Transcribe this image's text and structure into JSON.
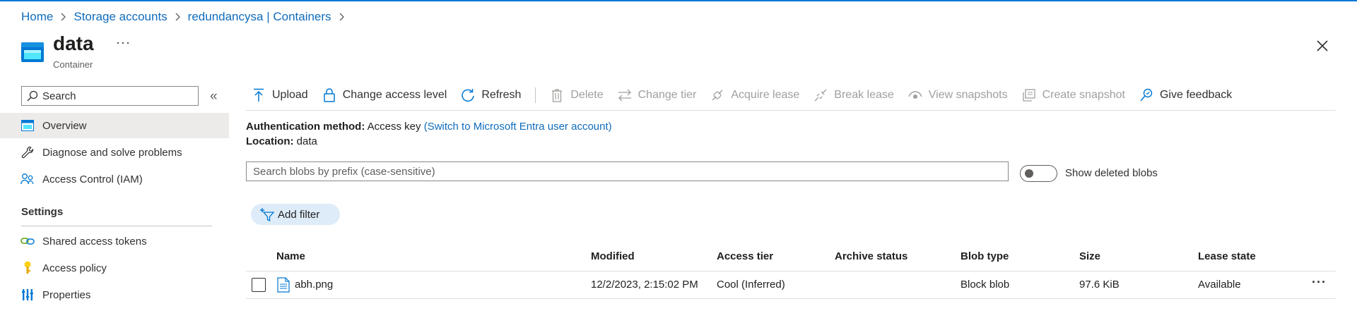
{
  "breadcrumb": {
    "items": [
      "Home",
      "Storage accounts",
      "redundancysa | Containers"
    ]
  },
  "header": {
    "title": "data",
    "subtitle": "Container",
    "more": "···",
    "icon": "container-icon"
  },
  "sidebar": {
    "search_placeholder": "Search",
    "collapse": "«",
    "items": [
      {
        "label": "Overview",
        "icon": "overview-icon",
        "active": true
      },
      {
        "label": "Diagnose and solve problems",
        "icon": "wrench-icon"
      },
      {
        "label": "Access Control (IAM)",
        "icon": "people-icon"
      }
    ],
    "section_settings": "Settings",
    "settings_items": [
      {
        "label": "Shared access tokens",
        "icon": "link-icon"
      },
      {
        "label": "Access policy",
        "icon": "key-icon"
      },
      {
        "label": "Properties",
        "icon": "properties-icon"
      }
    ]
  },
  "toolbar": {
    "upload": "Upload",
    "change_access_level": "Change access level",
    "refresh": "Refresh",
    "delete": "Delete",
    "change_tier": "Change tier",
    "acquire_lease": "Acquire lease",
    "break_lease": "Break lease",
    "view_snapshots": "View snapshots",
    "create_snapshot": "Create snapshot",
    "give_feedback": "Give feedback"
  },
  "info": {
    "auth_label": "Authentication method:",
    "auth_value": "Access key",
    "auth_link": "(Switch to Microsoft Entra user account)",
    "location_label": "Location:",
    "location_value": "data"
  },
  "blob_search": {
    "placeholder": "Search blobs by prefix (case-sensitive)"
  },
  "show_deleted": {
    "label": "Show deleted blobs",
    "on": false
  },
  "filter": {
    "label": "Add filter"
  },
  "table": {
    "columns": [
      "Name",
      "Modified",
      "Access tier",
      "Archive status",
      "Blob type",
      "Size",
      "Lease state"
    ],
    "rows": [
      {
        "name": "abh.png",
        "modified": "12/2/2023, 2:15:02 PM",
        "access_tier": "Cool (Inferred)",
        "archive_status": "",
        "blob_type": "Block blob",
        "size": "97.6 KiB",
        "lease_state": "Available"
      }
    ],
    "row_more": "···"
  },
  "colors": {
    "accent": "#0078d4",
    "link": "#0f6cbd",
    "active_bg": "#edebe9",
    "pill_bg": "#deecf9"
  }
}
